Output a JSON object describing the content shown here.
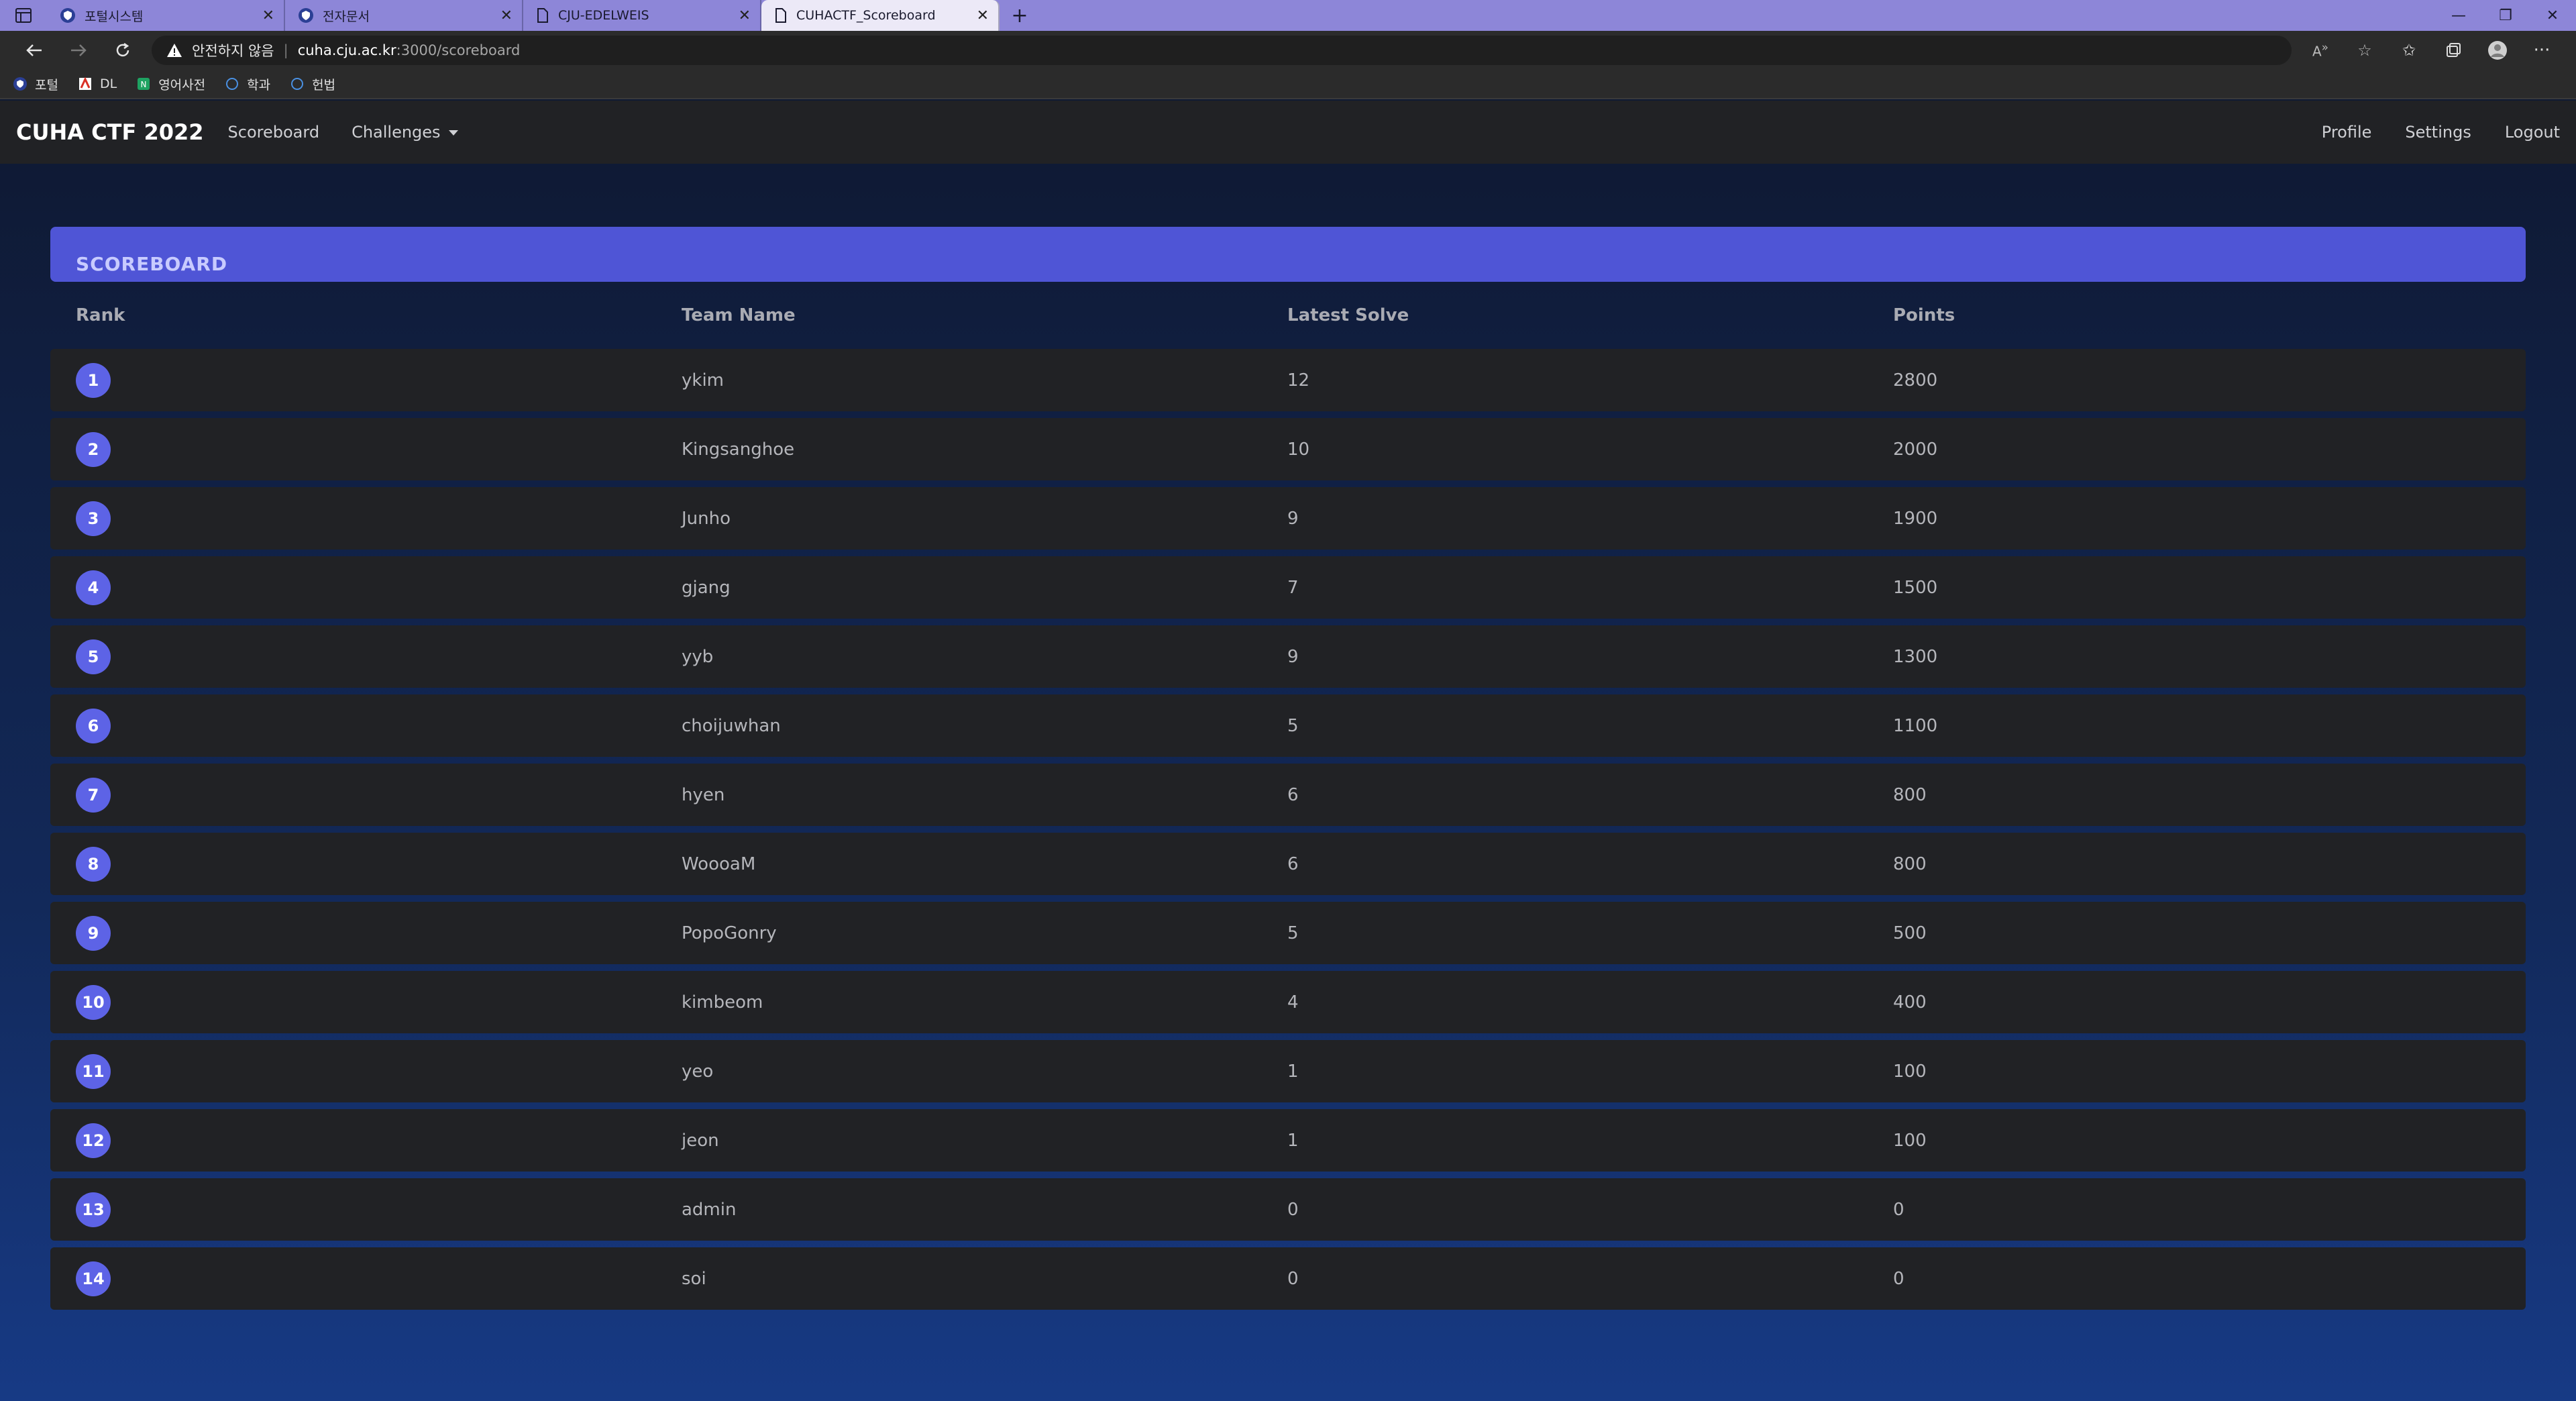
{
  "browser": {
    "tabs": [
      {
        "title": "포털시스템",
        "icon": "shield-icon",
        "active": false
      },
      {
        "title": "전자문서",
        "icon": "shield-icon",
        "active": false
      },
      {
        "title": "CJU-EDELWEIS",
        "icon": "document-icon",
        "active": false
      },
      {
        "title": "CUHACTF_Scoreboard",
        "icon": "document-icon",
        "active": true
      }
    ],
    "address": {
      "security_label": "안전하지 않음",
      "separator": "|",
      "host": "cuha.cju.ac.kr",
      "path": ":3000/scoreboard"
    },
    "bookmarks": [
      {
        "label": "포털",
        "icon": "shield-icon",
        "color": "#2b3f95"
      },
      {
        "label": "DL",
        "icon": "pdf-icon",
        "color": "#d93025"
      },
      {
        "label": "영어사전",
        "icon": "dictionary-icon",
        "color": "#1ea362"
      },
      {
        "label": "학과",
        "icon": "globe-icon",
        "color": "#4a90e2"
      },
      {
        "label": "헌법",
        "icon": "globe-icon",
        "color": "#4a90e2"
      }
    ]
  },
  "site": {
    "brand": "CUHA CTF 2022",
    "nav": {
      "scoreboard": "Scoreboard",
      "challenges": "Challenges",
      "profile": "Profile",
      "settings": "Settings",
      "logout": "Logout"
    }
  },
  "scoreboard": {
    "title": "SCOREBOARD",
    "columns": {
      "rank": "Rank",
      "team": "Team Name",
      "solve": "Latest Solve",
      "points": "Points"
    },
    "rows": [
      {
        "rank": "1",
        "team": "ykim",
        "solve": "12",
        "points": "2800"
      },
      {
        "rank": "2",
        "team": "Kingsanghoe",
        "solve": "10",
        "points": "2000"
      },
      {
        "rank": "3",
        "team": "Junho",
        "solve": "9",
        "points": "1900"
      },
      {
        "rank": "4",
        "team": "gjang",
        "solve": "7",
        "points": "1500"
      },
      {
        "rank": "5",
        "team": "yyb",
        "solve": "9",
        "points": "1300"
      },
      {
        "rank": "6",
        "team": "choijuwhan",
        "solve": "5",
        "points": "1100"
      },
      {
        "rank": "7",
        "team": "hyen",
        "solve": "6",
        "points": "800"
      },
      {
        "rank": "8",
        "team": "WoooaM",
        "solve": "6",
        "points": "800"
      },
      {
        "rank": "9",
        "team": "PopoGonry",
        "solve": "5",
        "points": "500"
      },
      {
        "rank": "10",
        "team": "kimbeom",
        "solve": "4",
        "points": "400"
      },
      {
        "rank": "11",
        "team": "yeo",
        "solve": "1",
        "points": "100"
      },
      {
        "rank": "12",
        "team": "jeon",
        "solve": "1",
        "points": "100"
      },
      {
        "rank": "13",
        "team": "admin",
        "solve": "0",
        "points": "0"
      },
      {
        "rank": "14",
        "team": "soi",
        "solve": "0",
        "points": "0"
      }
    ]
  },
  "colors": {
    "accent": "#5d63e6",
    "header_bar": "#4f55d6",
    "row_bg": "#212225"
  }
}
